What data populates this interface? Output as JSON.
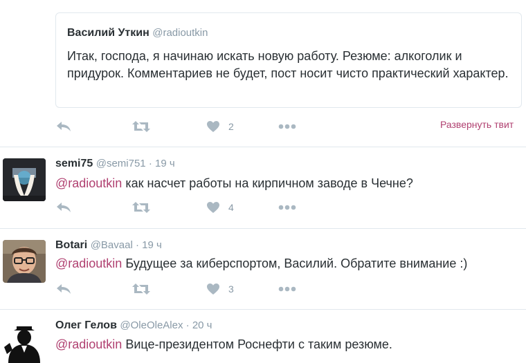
{
  "colors": {
    "mention": "#b04070",
    "muted": "#8899a6",
    "text": "#292f33",
    "border": "#e1e8ed",
    "icon": "#aab8c2"
  },
  "quoted_tweet": {
    "fullname": "Василий Уткин",
    "handle": "@radioutkin",
    "text": "Итак, господа, я начинаю искать новую работу. Резюме: алкоголик и придурок. Комментариев не будет, пост носит чисто практический характер."
  },
  "main_actions": {
    "likes": "2",
    "expand_label": "Развернуть твит"
  },
  "replies": [
    {
      "fullname": "semi75",
      "handle": "@semi751",
      "time": "19 ч",
      "mention": "@radioutkin",
      "text": " как насчет работы на кирпичном заводе в Чечне?",
      "likes": "4",
      "avatar_icon": "photo-avatar"
    },
    {
      "fullname": "Botari",
      "handle": "@Bavaal",
      "time": "19 ч",
      "mention": "@radioutkin",
      "text": " Будущее за киберспортом, Василий. Обратите внимание :)",
      "likes": "3",
      "avatar_icon": "man-glasses-avatar"
    },
    {
      "fullname": "Олег Гелов",
      "handle": "@OleOleAlex",
      "time": "20 ч",
      "mention": "@radioutkin",
      "text": " Вице-президентом Роснефти с таким резюме.",
      "avatar_icon": "silhouette-avatar"
    }
  ],
  "separator": " · "
}
